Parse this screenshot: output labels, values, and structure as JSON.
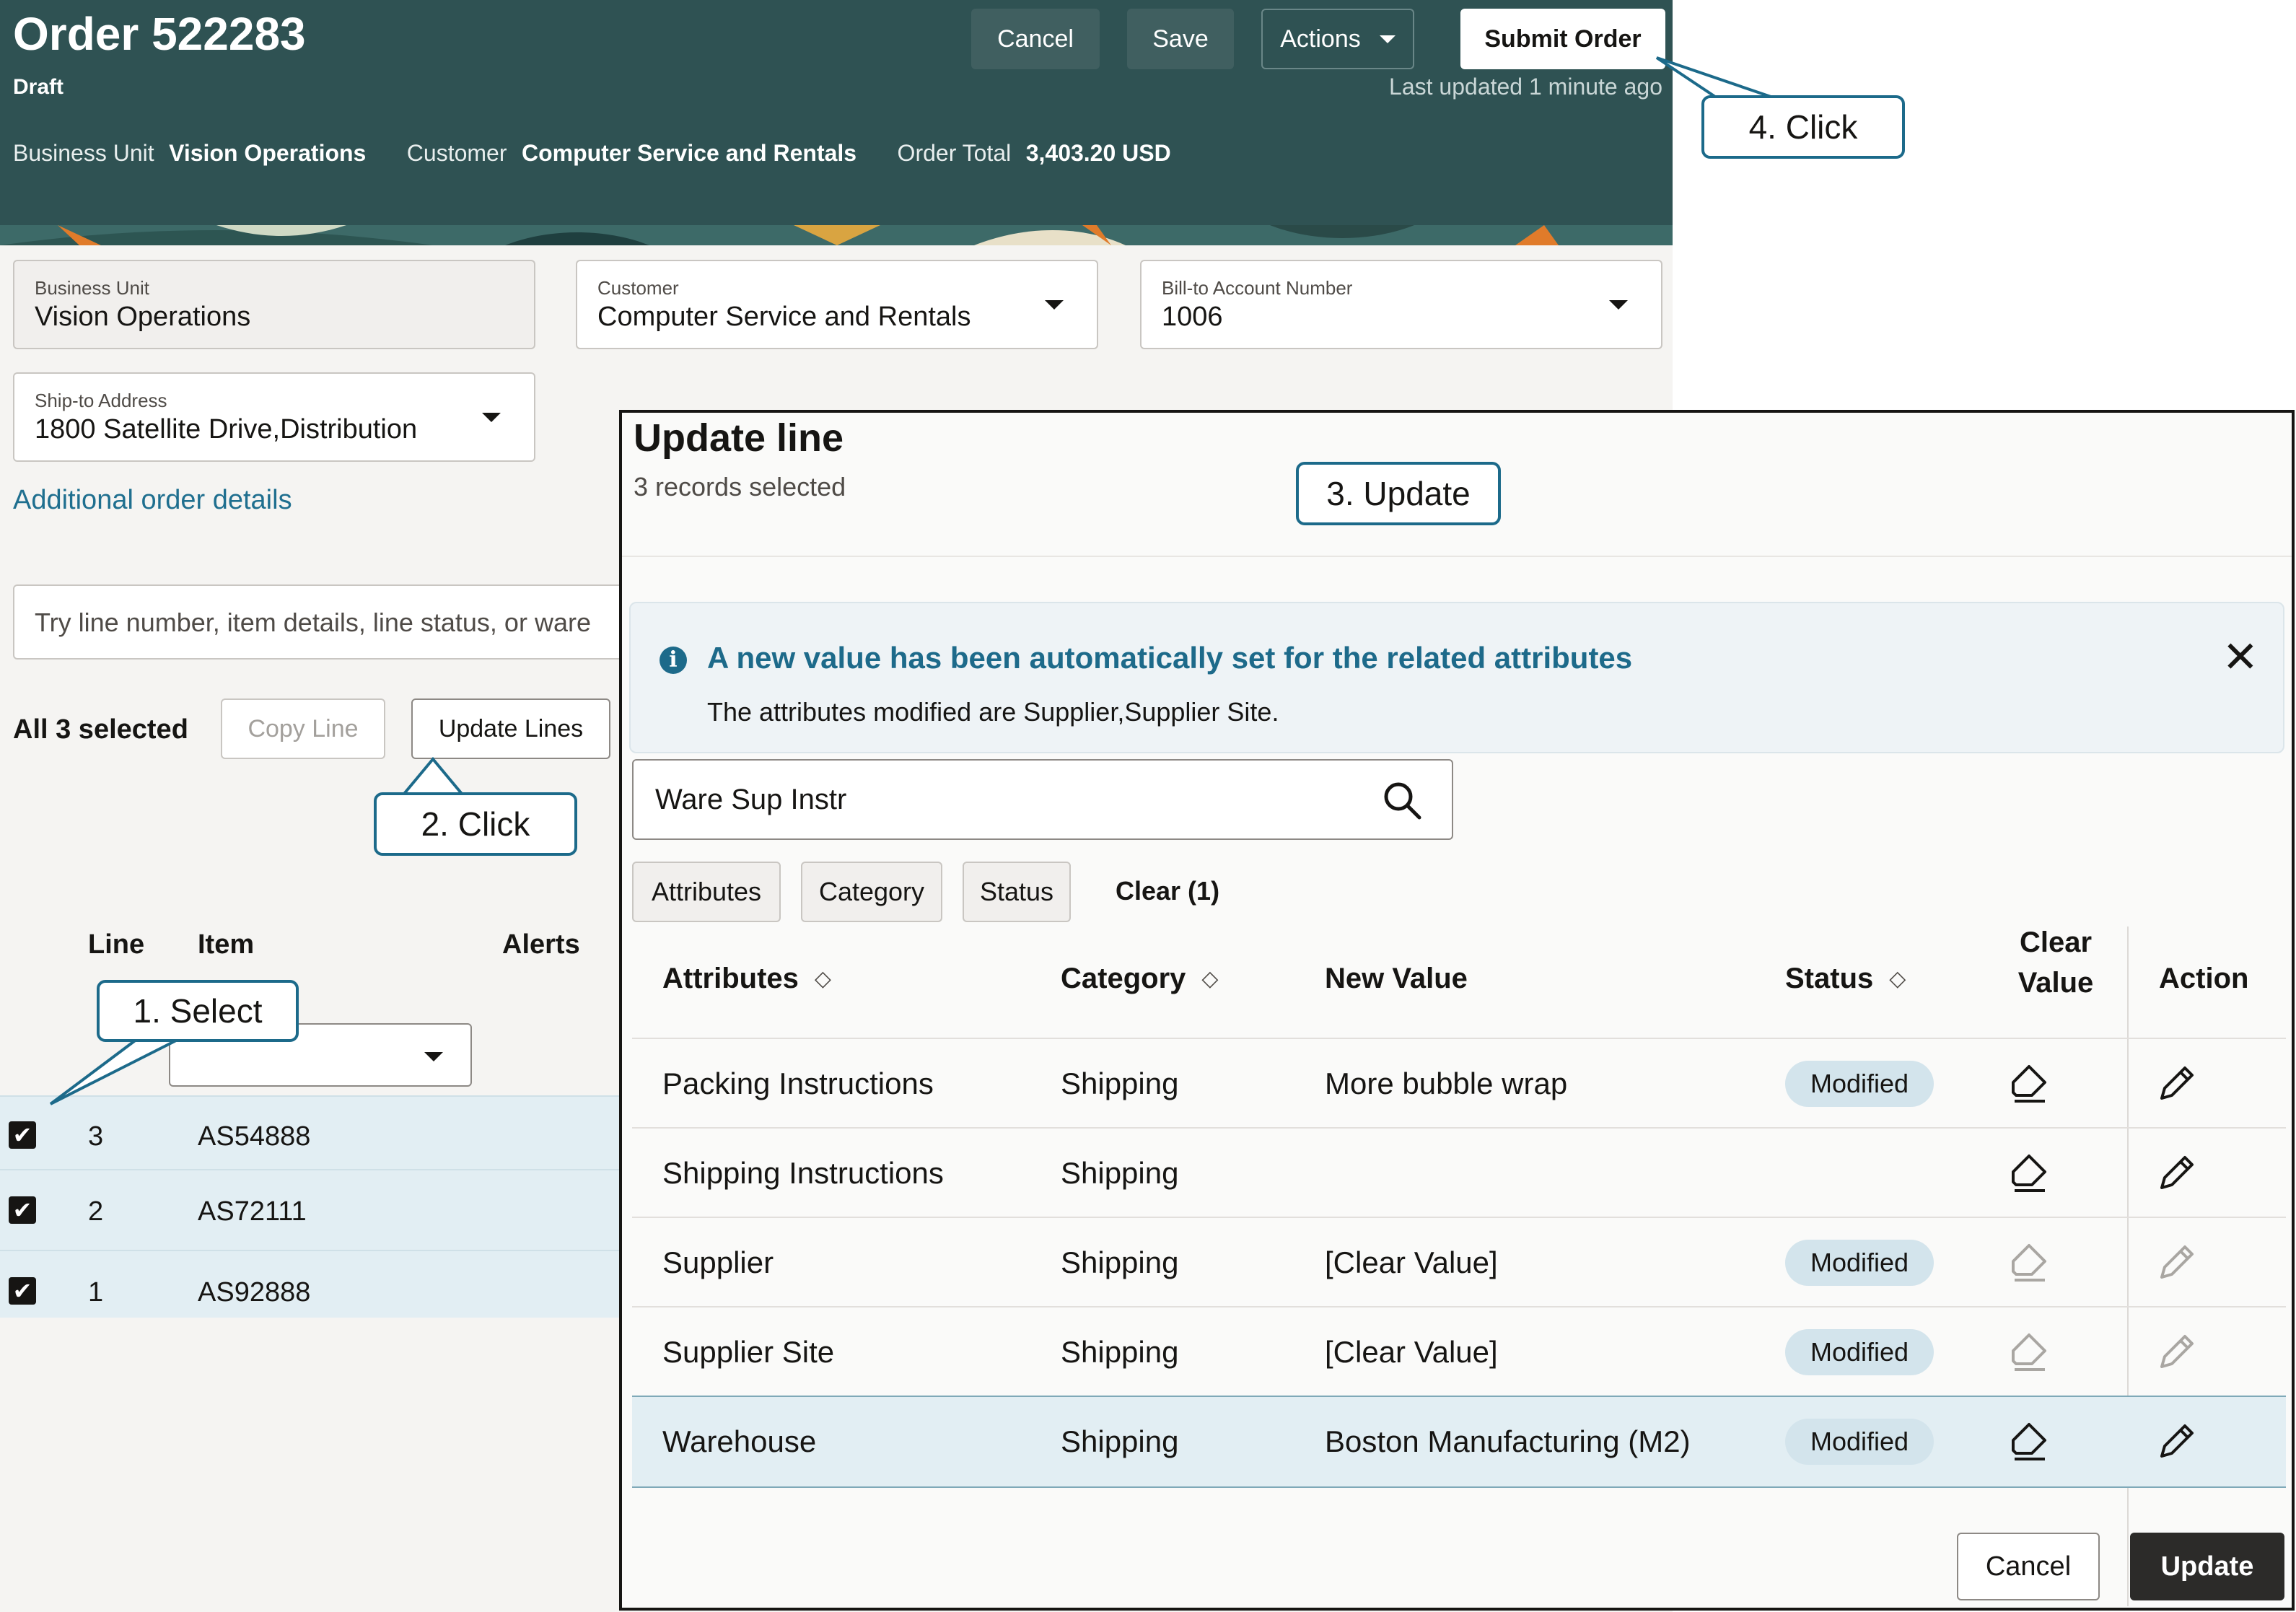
{
  "header": {
    "title": "Order 522283",
    "status": "Draft",
    "buttons": {
      "cancel": "Cancel",
      "save": "Save",
      "actions": "Actions",
      "submit": "Submit Order"
    },
    "last_updated": "Last updated 1 minute ago",
    "summary": {
      "business_unit_label": "Business Unit",
      "business_unit_value": "Vision Operations",
      "customer_label": "Customer",
      "customer_value": "Computer Service and Rentals",
      "order_total_label": "Order Total",
      "order_total_value": "3,403.20 USD"
    }
  },
  "form": {
    "business_unit": {
      "label": "Business Unit",
      "value": "Vision Operations"
    },
    "customer": {
      "label": "Customer",
      "value": "Computer Service and Rentals"
    },
    "bill_to": {
      "label": "Bill-to Account Number",
      "value": "1006"
    },
    "ship_to": {
      "label": "Ship-to Address",
      "value": "1800 Satellite Drive,Distribution"
    },
    "additional_link": "Additional order details"
  },
  "lines": {
    "search_placeholder": "Try line number, item details, line status, or ware",
    "selected_text": "All 3 selected",
    "copy_line": "Copy Line",
    "update_lines": "Update Lines",
    "columns": {
      "line": "Line",
      "item": "Item",
      "alerts": "Alerts"
    },
    "rows": [
      {
        "line": "3",
        "item": "AS54888"
      },
      {
        "line": "2",
        "item": "AS72111"
      },
      {
        "line": "1",
        "item": "AS92888"
      }
    ]
  },
  "modal": {
    "title": "Update line",
    "subtitle": "3 records selected",
    "info": {
      "title": "A new value has been automatically set for the related attributes",
      "text": "The attributes modified are Supplier,Supplier Site."
    },
    "search_value": "Ware Sup Instr",
    "chips": {
      "attributes": "Attributes",
      "category": "Category",
      "status": "Status",
      "clear": "Clear (1)"
    },
    "columns": {
      "attributes": "Attributes",
      "category": "Category",
      "new_value": "New Value",
      "status": "Status",
      "clear_value_1": "Clear",
      "clear_value_2": "Value",
      "action": "Action"
    },
    "rows": [
      {
        "attribute": "Packing Instructions",
        "category": "Shipping",
        "new_value": "More bubble wrap",
        "status": "Modified"
      },
      {
        "attribute": "Shipping Instructions",
        "category": "Shipping",
        "new_value": "",
        "status": ""
      },
      {
        "attribute": "Supplier",
        "category": "Shipping",
        "new_value": "[Clear Value]",
        "status": "Modified"
      },
      {
        "attribute": "Supplier Site",
        "category": "Shipping",
        "new_value": "[Clear Value]",
        "status": "Modified"
      },
      {
        "attribute": "Warehouse",
        "category": "Shipping",
        "new_value": "Boston Manufacturing (M2)",
        "status": "Modified"
      }
    ],
    "buttons": {
      "cancel": "Cancel",
      "update": "Update"
    }
  },
  "callouts": {
    "step1": "1. Select",
    "step2": "2. Click",
    "step3": "3. Update",
    "step4": "4. Click"
  },
  "colors": {
    "header": "#2f5253",
    "accent": "#1d6a8a",
    "selected_row": "#e2eef3",
    "badge": "#d3e4ec"
  }
}
